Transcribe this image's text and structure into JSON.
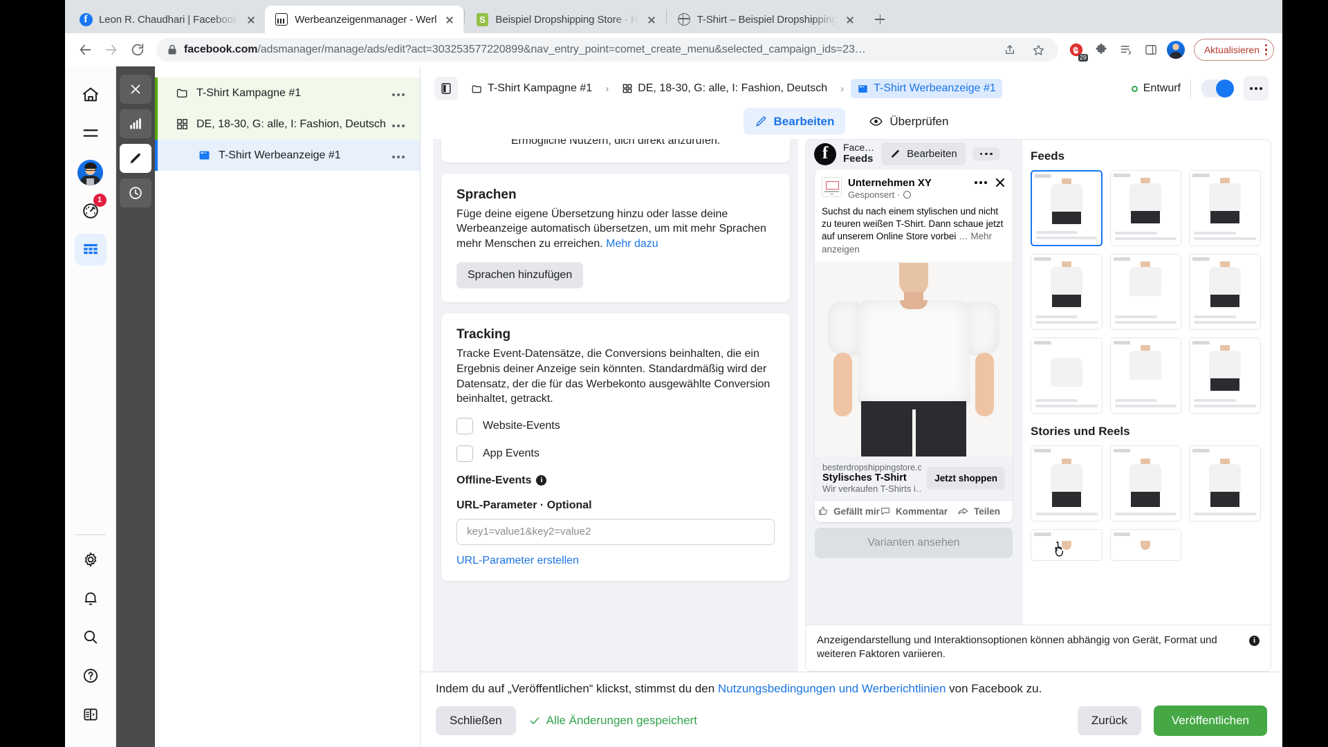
{
  "browser": {
    "tabs": [
      {
        "title": "Leon R. Chaudhari | Facebook",
        "favicon": "facebook-icon",
        "active": false
      },
      {
        "title": "Werbeanzeigenmanager - Werl",
        "favicon": "ads-manager-icon",
        "active": true
      },
      {
        "title": "Beispiel Dropshipping Store · H",
        "favicon": "shopify-icon",
        "active": false
      },
      {
        "title": "T-Shirt – Beispiel Dropshipping",
        "favicon": "globe-icon",
        "active": false
      }
    ],
    "url_bold": "facebook.com",
    "url_rest": "/adsmanager/manage/ads/edit?act=303253577220899&nav_entry_point=comet_create_menu&selected_campaign_ids=23…",
    "extension_badge": "29",
    "update_button": "Aktualisieren"
  },
  "rail": {
    "items": [
      {
        "name": "home-icon"
      },
      {
        "name": "menu-icon"
      },
      {
        "name": "profile-avatar"
      },
      {
        "name": "performance-icon",
        "badge": "1"
      },
      {
        "name": "table-icon",
        "active": true
      }
    ],
    "bottom": [
      {
        "name": "gear-icon"
      },
      {
        "name": "bell-icon"
      },
      {
        "name": "search-icon"
      },
      {
        "name": "help-icon"
      },
      {
        "name": "panel-toggle-icon"
      }
    ]
  },
  "toolstrip": [
    {
      "name": "close-icon"
    },
    {
      "name": "chart-icon"
    },
    {
      "name": "edit-icon",
      "active": true
    },
    {
      "name": "history-icon"
    }
  ],
  "tree": {
    "items": [
      {
        "label": "T-Shirt Kampagne #1",
        "icon": "folder-icon",
        "level": 0,
        "state": "campaign"
      },
      {
        "label": "DE, 18-30, G: alle, I: Fashion, Deutsch",
        "icon": "adset-icon",
        "level": 1,
        "state": "adset"
      },
      {
        "label": "T-Shirt Werbeanzeige #1",
        "icon": "ad-icon",
        "level": 2,
        "state": "ad-selected"
      }
    ]
  },
  "header": {
    "breadcrumbs": [
      {
        "label": "T-Shirt Kampagne #1",
        "icon": "folder-icon",
        "selected": false
      },
      {
        "label": "DE, 18-30, G: alle, I: Fashion, Deutsch",
        "icon": "adset-icon",
        "selected": false
      },
      {
        "label": "T-Shirt Werbeanzeige #1",
        "icon": "ad-icon",
        "selected": true
      }
    ],
    "status": "Entwurf",
    "tabs": [
      {
        "label": "Bearbeiten",
        "icon": "pencil-icon",
        "active": true
      },
      {
        "label": "Überprüfen",
        "icon": "eye-icon",
        "active": false
      }
    ]
  },
  "form": {
    "clipped_text": "Ermögliche Nutzern, dich direkt anzurufen.",
    "languages": {
      "title": "Sprachen",
      "description": "Füge deine eigene Übersetzung hinzu oder lasse deine Werbeanzeige automatisch übersetzen, um mit mehr Sprachen mehr Menschen zu erreichen. ",
      "link": "Mehr dazu",
      "button": "Sprachen hinzufügen"
    },
    "tracking": {
      "title": "Tracking",
      "description": "Tracke Event-Datensätze, die Conversions beinhalten, die ein Ergebnis deiner Anzeige sein könnten. Standardmäßig wird der Datensatz, der die für das Werbekonto ausgewählte Conversion beinhaltet, getrackt.",
      "checkboxes": [
        {
          "label": "Website-Events",
          "checked": false
        },
        {
          "label": "App Events",
          "checked": false
        }
      ],
      "offline_label": "Offline-Events",
      "url_param_label": "URL-Parameter · Optional",
      "url_param_placeholder": "key1=value1&key2=value2",
      "url_param_value": "",
      "create_link": "URL-Parameter erstellen"
    }
  },
  "preview": {
    "platform_small": "Face…",
    "platform_name": "Feeds",
    "edit_button": "Bearbeiten",
    "ad": {
      "advertiser": "Unternehmen XY",
      "sponsored": "Gesponsert",
      "body": "Suchst du nach einem stylischen und nicht zu teuren weißen T-Shirt. Dann schaue jetzt auf unserem Online Store vorbei",
      "more": "… Mehr anzeigen",
      "domain": "besterdropshippingstore.c…",
      "headline": "Stylisches T-Shirt",
      "description": "Wir verkaufen T-Shirts i…",
      "cta": "Jetzt shoppen",
      "actions": [
        "Gefällt mir",
        "Kommentar",
        "Teilen"
      ]
    },
    "variants_button": "Varianten ansehen",
    "note": "Anzeigendarstellung und Interaktionsoptionen können abhängig von Gerät, Format und weiteren Faktoren variieren."
  },
  "placements": {
    "feeds_title": "Feeds",
    "stories_title": "Stories und Reels",
    "feeds_count": 9,
    "stories_count": 5,
    "selected_index": 0
  },
  "footer": {
    "legal_pre": "Indem du auf „Veröffentlichen“ klickst, stimmst du den ",
    "legal_link1": "Nutzungsbedingungen und Werberichtlinien",
    "legal_post": " von Facebook zu.",
    "close_button": "Schließen",
    "saved_text": "Alle Änderungen gespeichert",
    "back_button": "Zurück",
    "publish_button": "Veröffentlichen"
  },
  "colors": {
    "fb_blue": "#1877f2",
    "green": "#45a845",
    "campaign_green": "#58a700",
    "draft_green": "#31a24c"
  }
}
